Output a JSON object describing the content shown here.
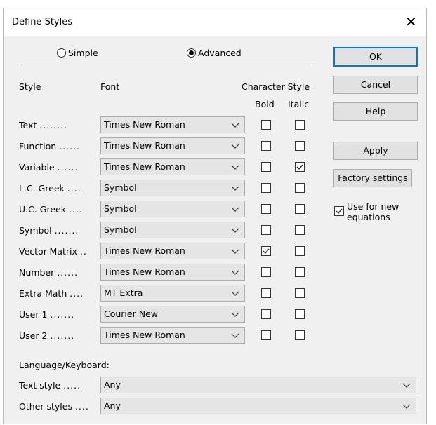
{
  "dialog": {
    "title": "Define Styles",
    "close_glyph": "✕"
  },
  "mode": {
    "simple_label": "Simple",
    "advanced_label": "Advanced",
    "selected": "Advanced"
  },
  "headers": {
    "style": "Style",
    "font": "Font",
    "character_style": "Character Style",
    "bold": "Bold",
    "italic": "Italic"
  },
  "styles": [
    {
      "name": "Text",
      "dots": "........",
      "font": "Times New Roman",
      "bold": false,
      "italic": false
    },
    {
      "name": "Function",
      "dots": "......",
      "font": "Times New Roman",
      "bold": false,
      "italic": false
    },
    {
      "name": "Variable",
      "dots": "......",
      "font": "Times New Roman",
      "bold": false,
      "italic": true
    },
    {
      "name": "L.C. Greek",
      "dots": "....",
      "font": "Symbol",
      "bold": false,
      "italic": false
    },
    {
      "name": "U.C. Greek",
      "dots": "....",
      "font": "Symbol",
      "bold": false,
      "italic": false
    },
    {
      "name": "Symbol",
      "dots": ".......",
      "font": "Symbol",
      "bold": false,
      "italic": false
    },
    {
      "name": "Vector-Matrix",
      "dots": "..",
      "font": "Times New Roman",
      "bold": true,
      "italic": false
    },
    {
      "name": "Number",
      "dots": "......",
      "font": "Times New Roman",
      "bold": false,
      "italic": false
    },
    {
      "name": "Extra Math",
      "dots": "....",
      "font": "MT Extra",
      "bold": false,
      "italic": false
    },
    {
      "name": "User 1",
      "dots": ".......",
      "font": "Courier New",
      "bold": false,
      "italic": false
    },
    {
      "name": "User 2",
      "dots": ".......",
      "font": "Times New Roman",
      "bold": false,
      "italic": false
    }
  ],
  "buttons": {
    "ok": "OK",
    "cancel": "Cancel",
    "help": "Help",
    "apply": "Apply",
    "factory": "Factory settings"
  },
  "use_for_new": {
    "label_line1": "Use for new",
    "label_line2": "equations",
    "checked": true
  },
  "language": {
    "heading": "Language/Keyboard:",
    "text_style_label": "Text style",
    "text_style_dots": ".....",
    "text_style_value": "Any",
    "other_styles_label": "Other styles",
    "other_styles_dots": "....",
    "other_styles_value": "Any"
  }
}
